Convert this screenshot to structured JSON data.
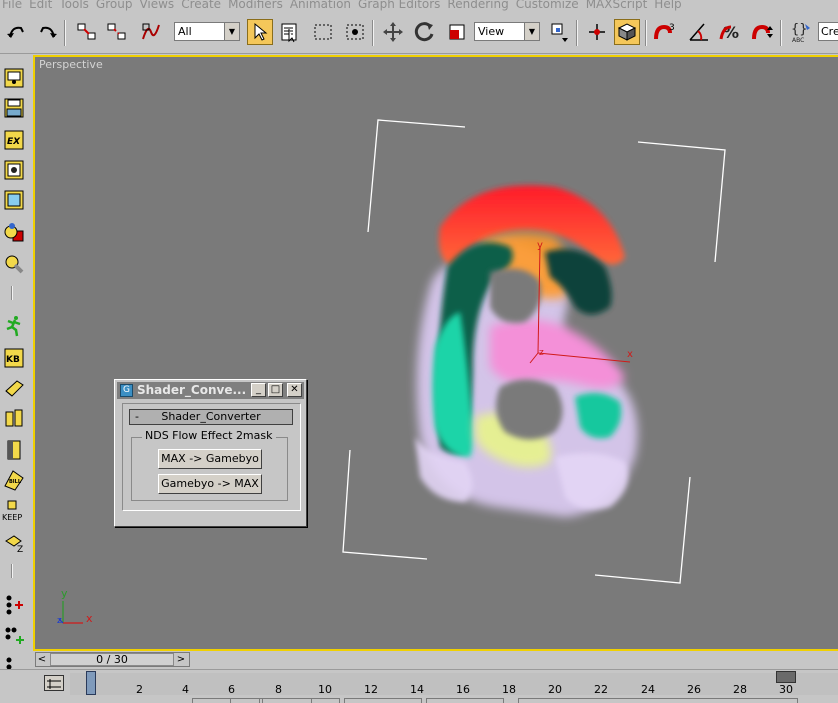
{
  "menu": [
    "File",
    "Edit",
    "Tools",
    "Group",
    "Views",
    "Create",
    "Modifiers",
    "Animation",
    "Graph Editors",
    "Rendering",
    "Customize",
    "MAXScript",
    "Help"
  ],
  "toolbar": {
    "selection_filter": "All",
    "reference_coord": "View",
    "create_selection_set": "Crea"
  },
  "viewport": {
    "label": "Perspective",
    "axis_x": "x",
    "axis_y": "y",
    "axis_z": "z"
  },
  "dialog": {
    "title": "Shader_Conve...",
    "rollout_title": "Shader_Converter",
    "rollout_toggle": "-",
    "group_label": "NDS Flow Effect 2mask",
    "btn_max_to_gamebyo": "MAX -> Gamebyo",
    "btn_gamebyo_to_max": "Gamebyo -> MAX",
    "min_label": "_",
    "max_label": "□",
    "close_label": "✕"
  },
  "time_slider": {
    "frame_display": "0 / 30",
    "prev": "<",
    "next": ">"
  },
  "track_bar": {
    "ticks": [
      "2",
      "4",
      "6",
      "8",
      "10",
      "12",
      "14",
      "16",
      "18",
      "20",
      "22",
      "24",
      "26",
      "28",
      "30"
    ]
  },
  "colors": {
    "viewport_bg": "#7a7a7a",
    "active_border": "#f0d000",
    "ui_gray": "#c6c6c6",
    "active_tool": "#f4c75a"
  }
}
